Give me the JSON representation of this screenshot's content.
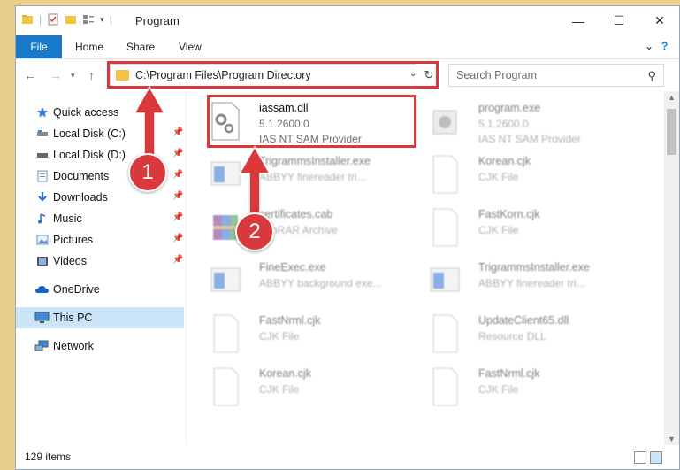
{
  "window": {
    "title": "Program",
    "minimize_glyph": "—",
    "maximize_glyph": "☐",
    "close_glyph": "✕"
  },
  "ribbon": {
    "tabs": [
      "File",
      "Home",
      "Share",
      "View"
    ],
    "expand_glyph": "⌄",
    "help_glyph": "?"
  },
  "address": {
    "path": "C:\\Program Files\\Program Directory",
    "search_placeholder": "Search Program"
  },
  "sidebar": {
    "items": [
      {
        "label": "Quick access",
        "icon": "star-icon",
        "pinned": false
      },
      {
        "label": "Local Disk (C:)",
        "icon": "drive-icon",
        "pinned": true
      },
      {
        "label": "Local Disk (D:)",
        "icon": "drive-icon",
        "pinned": true
      },
      {
        "label": "Documents",
        "icon": "documents-icon",
        "pinned": true
      },
      {
        "label": "Downloads",
        "icon": "download-icon",
        "pinned": true
      },
      {
        "label": "Music",
        "icon": "music-icon",
        "pinned": true
      },
      {
        "label": "Pictures",
        "icon": "pictures-icon",
        "pinned": true
      },
      {
        "label": "Videos",
        "icon": "videos-icon",
        "pinned": true
      },
      {
        "label": "OneDrive",
        "icon": "cloud-icon",
        "pinned": false
      },
      {
        "label": "This PC",
        "icon": "computer-icon",
        "pinned": false,
        "selected": true
      },
      {
        "label": "Network",
        "icon": "network-icon",
        "pinned": false
      }
    ]
  },
  "files": [
    {
      "name": "iassam.dll",
      "line1": "5.1.2600.0",
      "line2": "IAS NT SAM Provider",
      "icon": "dll-gear-icon",
      "highlighted": true
    },
    {
      "name": "program.exe",
      "line1": "5.1.2600.0",
      "line2": "IAS NT SAM Provider",
      "icon": "exe-icon"
    },
    {
      "name": "TrigrammsInstaller.exe",
      "line1": "ABBYY finereader tri...",
      "line2": "",
      "icon": "app-window-icon"
    },
    {
      "name": "Korean.cjk",
      "line1": "CJK File",
      "line2": "",
      "icon": "blank-file-icon"
    },
    {
      "name": "certificates.cab",
      "line1": "WinRAR Archive",
      "line2": "",
      "icon": "archive-icon"
    },
    {
      "name": "FastKorn.cjk",
      "line1": "CJK File",
      "line2": "",
      "icon": "blank-file-icon"
    },
    {
      "name": "FineExec.exe",
      "line1": "ABBYY background exe...",
      "line2": "",
      "icon": "app-window-icon"
    },
    {
      "name": "TrigrammsInstaller.exe",
      "line1": "ABBYY finereader tri...",
      "line2": "",
      "icon": "app-window-icon"
    },
    {
      "name": "FastNrml.cjk",
      "line1": "CJK File",
      "line2": "",
      "icon": "blank-file-icon"
    },
    {
      "name": "UpdateClient65.dll",
      "line1": "Resource DLL",
      "line2": "",
      "icon": "blank-file-icon"
    },
    {
      "name": "Korean.cjk",
      "line1": "CJK File",
      "line2": "",
      "icon": "blank-file-icon"
    },
    {
      "name": "FastNrml.cjk",
      "line1": "CJK File",
      "line2": "",
      "icon": "blank-file-icon"
    }
  ],
  "status": {
    "item_count": "129 items"
  },
  "callouts": {
    "step1": "1",
    "step2": "2",
    "accent": "#d9393c"
  },
  "colors": {
    "file_tab": "#1979ca",
    "selected_nav": "#cce4f7",
    "highlight": "#d9393c"
  }
}
